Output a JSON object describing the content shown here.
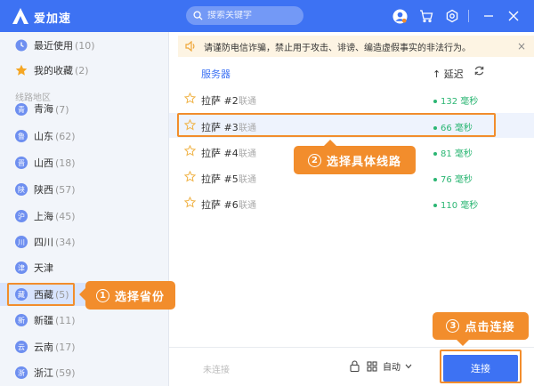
{
  "app": {
    "title": "爱加速"
  },
  "search": {
    "placeholder": "搜索关键字"
  },
  "sidebar": {
    "recent": {
      "label": "最近使用",
      "count": "(10)"
    },
    "favorites": {
      "label": "我的收藏",
      "count": "(2)"
    },
    "section_header": "线路地区",
    "provinces": [
      {
        "icon": "青",
        "label": "青海",
        "count": "(7)"
      },
      {
        "icon": "鲁",
        "label": "山东",
        "count": "(62)"
      },
      {
        "icon": "晋",
        "label": "山西",
        "count": "(18)"
      },
      {
        "icon": "陕",
        "label": "陕西",
        "count": "(57)"
      },
      {
        "icon": "沪",
        "label": "上海",
        "count": "(45)"
      },
      {
        "icon": "川",
        "label": "四川",
        "count": "(34)"
      },
      {
        "icon": "津",
        "label": "天津",
        "count": ""
      },
      {
        "icon": "藏",
        "label": "西藏",
        "count": "(5)"
      },
      {
        "icon": "新",
        "label": "新疆",
        "count": "(11)"
      },
      {
        "icon": "云",
        "label": "云南",
        "count": "(17)"
      },
      {
        "icon": "浙",
        "label": "浙江",
        "count": "(59)"
      }
    ]
  },
  "notice": {
    "text": "请谨防电信诈骗，禁止用于攻击、诽谤、编造虚假事实的非法行为。",
    "close": "×"
  },
  "list": {
    "col_server": "服务器",
    "col_latency": "↑ 延迟",
    "rows": [
      {
        "name": "拉萨 #2",
        "isp": "联通",
        "latency": "132 毫秒"
      },
      {
        "name": "拉萨 #3",
        "isp": "联通",
        "latency": "66 毫秒"
      },
      {
        "name": "拉萨 #4",
        "isp": "联通",
        "latency": "81 毫秒"
      },
      {
        "name": "拉萨 #5",
        "isp": "联通",
        "latency": "76 毫秒"
      },
      {
        "name": "拉萨 #6",
        "isp": "联通",
        "latency": "110 毫秒"
      }
    ]
  },
  "callouts": {
    "step1": {
      "num": "1",
      "text": "选择省份"
    },
    "step2": {
      "num": "2",
      "text": "选择具体线路"
    },
    "step3": {
      "num": "3",
      "text": "点击连接"
    }
  },
  "bottom": {
    "status": "未连接",
    "mode": "自动",
    "connect": "连接"
  },
  "colors": {
    "primary": "#3d72f3",
    "accent": "#f28d2c",
    "latency": "#2bb673"
  }
}
